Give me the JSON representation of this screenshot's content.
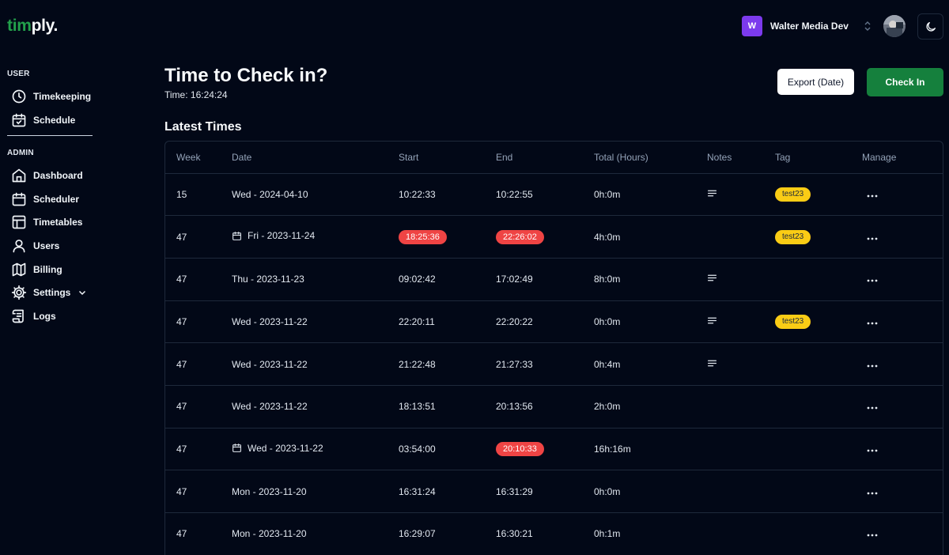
{
  "brand": {
    "prefix": "tim",
    "suffix": "ply."
  },
  "header": {
    "org_initial": "W",
    "org_name": "Walter Media Dev"
  },
  "sidebar": {
    "user_section": "USER",
    "admin_section": "ADMIN",
    "user_items": [
      {
        "label": "Timekeeping",
        "icon": "clock-icon"
      },
      {
        "label": "Schedule",
        "icon": "calendar-check-icon"
      }
    ],
    "admin_items": [
      {
        "label": "Dashboard",
        "icon": "home-icon"
      },
      {
        "label": "Scheduler",
        "icon": "calendar-icon"
      },
      {
        "label": "Timetables",
        "icon": "table-icon"
      },
      {
        "label": "Users",
        "icon": "user-icon"
      },
      {
        "label": "Billing",
        "icon": "map-icon"
      },
      {
        "label": "Settings",
        "icon": "gear-icon"
      },
      {
        "label": "Logs",
        "icon": "scroll-icon"
      }
    ]
  },
  "main": {
    "title": "Time to Check in?",
    "time_label": "Time: 16:24:24",
    "export_label": "Export (Date)",
    "checkin_label": "Check In",
    "section_title": "Latest Times"
  },
  "table": {
    "columns": [
      "Week",
      "Date",
      "Start",
      "End",
      "Total (Hours)",
      "Notes",
      "Tag",
      "Manage"
    ],
    "rows": [
      {
        "week": "15",
        "date": "Wed - 2024-04-10",
        "date_icon": false,
        "start": "10:22:33",
        "start_flag": false,
        "end": "10:22:55",
        "end_flag": false,
        "total": "0h:0m",
        "notes": true,
        "tag": "test23"
      },
      {
        "week": "47",
        "date": "Fri - 2023-11-24",
        "date_icon": true,
        "start": "18:25:36",
        "start_flag": true,
        "end": "22:26:02",
        "end_flag": true,
        "total": "4h:0m",
        "notes": false,
        "tag": "test23"
      },
      {
        "week": "47",
        "date": "Thu - 2023-11-23",
        "date_icon": false,
        "start": "09:02:42",
        "start_flag": false,
        "end": "17:02:49",
        "end_flag": false,
        "total": "8h:0m",
        "notes": true,
        "tag": ""
      },
      {
        "week": "47",
        "date": "Wed - 2023-11-22",
        "date_icon": false,
        "start": "22:20:11",
        "start_flag": false,
        "end": "22:20:22",
        "end_flag": false,
        "total": "0h:0m",
        "notes": true,
        "tag": "test23"
      },
      {
        "week": "47",
        "date": "Wed - 2023-11-22",
        "date_icon": false,
        "start": "21:22:48",
        "start_flag": false,
        "end": "21:27:33",
        "end_flag": false,
        "total": "0h:4m",
        "notes": true,
        "tag": ""
      },
      {
        "week": "47",
        "date": "Wed - 2023-11-22",
        "date_icon": false,
        "start": "18:13:51",
        "start_flag": false,
        "end": "20:13:56",
        "end_flag": false,
        "total": "2h:0m",
        "notes": false,
        "tag": ""
      },
      {
        "week": "47",
        "date": "Wed - 2023-11-22",
        "date_icon": true,
        "start": "03:54:00",
        "start_flag": false,
        "end": "20:10:33",
        "end_flag": true,
        "total": "16h:16m",
        "notes": false,
        "tag": ""
      },
      {
        "week": "47",
        "date": "Mon - 2023-11-20",
        "date_icon": false,
        "start": "16:31:24",
        "start_flag": false,
        "end": "16:31:29",
        "end_flag": false,
        "total": "0h:0m",
        "notes": false,
        "tag": ""
      },
      {
        "week": "47",
        "date": "Mon - 2023-11-20",
        "date_icon": false,
        "start": "16:29:07",
        "start_flag": false,
        "end": "16:30:21",
        "end_flag": false,
        "total": "0h:1m",
        "notes": false,
        "tag": ""
      }
    ]
  },
  "colors": {
    "background": "#020817",
    "brand_green": "#22a04b",
    "checkin_green": "#15803d",
    "flag_red": "#ef4444",
    "tag_yellow": "#facc15",
    "org_purple": "#7c3aed"
  }
}
